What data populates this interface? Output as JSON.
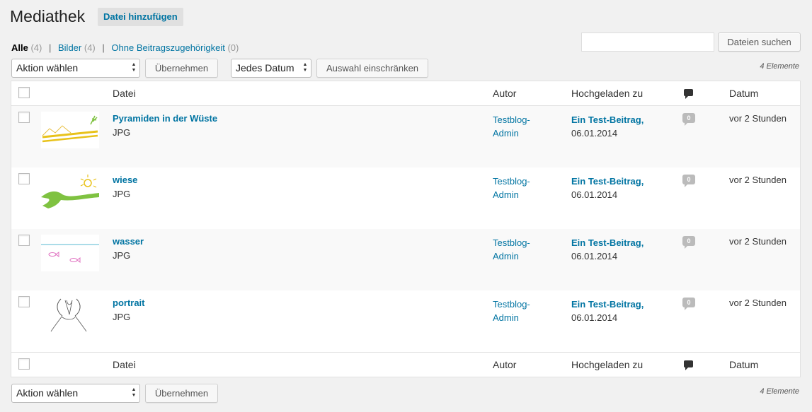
{
  "header": {
    "title": "Mediathek",
    "add_new": "Datei hinzufügen"
  },
  "filters": [
    {
      "label": "Alle",
      "count": "(4)",
      "current": true
    },
    {
      "label": "Bilder",
      "count": "(4)",
      "current": false
    },
    {
      "label": "Ohne Beitragszugehörigkeit",
      "count": "(0)",
      "current": false
    }
  ],
  "search": {
    "value": "",
    "button": "Dateien suchen"
  },
  "toolbar_top": {
    "bulk_action": "Aktion wählen",
    "apply": "Übernehmen",
    "date_filter": "Jedes Datum",
    "filter_button": "Auswahl einschränken",
    "count": "4 Elemente"
  },
  "toolbar_bottom": {
    "bulk_action": "Aktion wählen",
    "apply": "Übernehmen",
    "count": "4 Elemente"
  },
  "columns": {
    "file": "Datei",
    "author": "Autor",
    "attached": "Hochgeladen zu",
    "comments_icon": "comment-bubble-icon",
    "date": "Datum"
  },
  "rows": [
    {
      "title": "Pyramiden in der Wüste",
      "type": "JPG",
      "author_line1": "Testblog-",
      "author_line2": "Admin",
      "parent": "Ein Test-Beitrag,",
      "parent_date": "06.01.2014",
      "comments": "0",
      "date": "vor 2 Stunden"
    },
    {
      "title": "wiese",
      "type": "JPG",
      "author_line1": "Testblog-",
      "author_line2": "Admin",
      "parent": "Ein Test-Beitrag,",
      "parent_date": "06.01.2014",
      "comments": "0",
      "date": "vor 2 Stunden"
    },
    {
      "title": "wasser",
      "type": "JPG",
      "author_line1": "Testblog-",
      "author_line2": "Admin",
      "parent": "Ein Test-Beitrag,",
      "parent_date": "06.01.2014",
      "comments": "0",
      "date": "vor 2 Stunden"
    },
    {
      "title": "portrait",
      "type": "JPG",
      "author_line1": "Testblog-",
      "author_line2": "Admin",
      "parent": "Ein Test-Beitrag,",
      "parent_date": "06.01.2014",
      "comments": "0",
      "date": "vor 2 Stunden"
    }
  ],
  "colors": {
    "link": "#0074a2",
    "background": "#f1f1f1",
    "row_alt": "#f9f9f9"
  }
}
